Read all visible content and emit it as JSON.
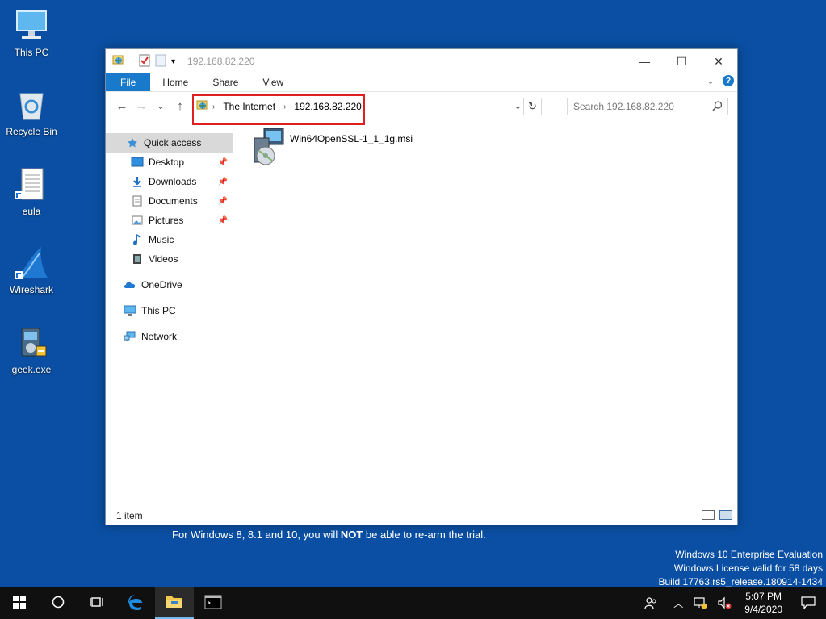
{
  "desktop": {
    "icons": [
      {
        "label": "This PC",
        "icon": "this-pc-icon"
      },
      {
        "label": "Recycle Bin",
        "icon": "recycle-bin-icon"
      },
      {
        "label": "eula",
        "icon": "text-file-icon"
      },
      {
        "label": "Wireshark",
        "icon": "wireshark-icon"
      },
      {
        "label": "geek.exe",
        "icon": "installer-icon"
      }
    ]
  },
  "explorer": {
    "title": "192.168.82.220",
    "window_controls": {
      "minimize": "—",
      "maximize": "☐",
      "close": "✕"
    },
    "ribbon": {
      "tabs": [
        "File",
        "Home",
        "Share",
        "View"
      ],
      "help": "?"
    },
    "nav": {
      "back": "←",
      "forward": "→",
      "recent": "⌄",
      "up": "↑"
    },
    "address": {
      "crumbs": [
        "The Internet",
        "192.168.82.220"
      ]
    },
    "search": {
      "placeholder": "Search 192.168.82.220"
    },
    "sidebar": {
      "items": [
        {
          "label": "Quick access",
          "icon": "star-icon",
          "pinned": false
        },
        {
          "label": "Desktop",
          "icon": "desktop-folder-icon",
          "pinned": true
        },
        {
          "label": "Downloads",
          "icon": "download-icon",
          "pinned": true
        },
        {
          "label": "Documents",
          "icon": "documents-icon",
          "pinned": true
        },
        {
          "label": "Pictures",
          "icon": "pictures-icon",
          "pinned": true
        },
        {
          "label": "Music",
          "icon": "music-icon",
          "pinned": false
        },
        {
          "label": "Videos",
          "icon": "videos-icon",
          "pinned": false
        },
        {
          "label": "OneDrive",
          "icon": "onedrive-icon",
          "pinned": false
        },
        {
          "label": "This PC",
          "icon": "this-pc-icon",
          "pinned": false
        },
        {
          "label": "Network",
          "icon": "network-icon",
          "pinned": false
        }
      ]
    },
    "files": [
      {
        "name": "Win64OpenSSL-1_1_1g.msi",
        "icon": "msi-installer-icon"
      }
    ],
    "status": {
      "count": "1 item"
    }
  },
  "note": {
    "before": "For Windows 8, 8.1 and 10, you will ",
    "bold": "NOT",
    "after": " be able to re-arm the trial."
  },
  "watermark": {
    "line1": "Windows 10 Enterprise Evaluation",
    "line2": "Windows License valid for 58 days",
    "line3": "Build 17763.rs5_release.180914-1434"
  },
  "taskbar": {
    "time": "5:07 PM",
    "date": "9/4/2020"
  },
  "colors": {
    "desktop": "#0a4fa3",
    "accent": "#1979ca",
    "highlight_box": "#e02020"
  }
}
